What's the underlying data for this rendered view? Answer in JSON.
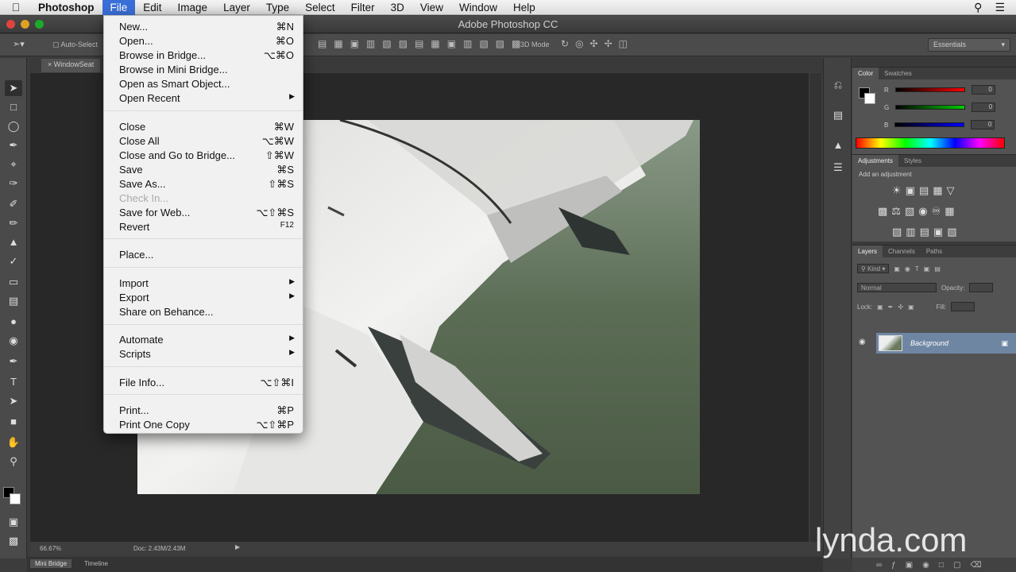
{
  "menubar": {
    "app_name": "Photoshop",
    "items": [
      "File",
      "Edit",
      "Image",
      "Layer",
      "Type",
      "Select",
      "Filter",
      "3D",
      "View",
      "Window",
      "Help"
    ],
    "active": "File"
  },
  "window": {
    "title": "Adobe Photoshop CC"
  },
  "options": {
    "auto_select": "Auto-Select",
    "mode_3d": "3D Mode",
    "workspace": "Essentials"
  },
  "document": {
    "tab": "WindowSeat"
  },
  "file_menu": {
    "items": [
      {
        "label": "New...",
        "shortcut": "⌘N"
      },
      {
        "label": "Open...",
        "shortcut": "⌘O"
      },
      {
        "label": "Browse in Bridge...",
        "shortcut": "⌥⌘O"
      },
      {
        "label": "Browse in Mini Bridge...",
        "shortcut": ""
      },
      {
        "label": "Open as Smart Object...",
        "shortcut": ""
      },
      {
        "label": "Open Recent",
        "shortcut": "",
        "submenu": true
      },
      {
        "label": "Close",
        "shortcut": "⌘W"
      },
      {
        "label": "Close All",
        "shortcut": "⌥⌘W"
      },
      {
        "label": "Close and Go to Bridge...",
        "shortcut": "⇧⌘W"
      },
      {
        "label": "Save",
        "shortcut": "⌘S"
      },
      {
        "label": "Save As...",
        "shortcut": "⇧⌘S"
      },
      {
        "label": "Check In...",
        "shortcut": "",
        "disabled": true
      },
      {
        "label": "Save for Web...",
        "shortcut": "⌥⇧⌘S"
      },
      {
        "label": "Revert",
        "shortcut": "F12"
      },
      {
        "label": "Place...",
        "shortcut": ""
      },
      {
        "label": "Import",
        "shortcut": "",
        "submenu": true
      },
      {
        "label": "Export",
        "shortcut": "",
        "submenu": true
      },
      {
        "label": "Share on Behance...",
        "shortcut": ""
      },
      {
        "label": "Automate",
        "shortcut": "",
        "submenu": true
      },
      {
        "label": "Scripts",
        "shortcut": "",
        "submenu": true
      },
      {
        "label": "File Info...",
        "shortcut": "⌥⇧⌘I"
      },
      {
        "label": "Print...",
        "shortcut": "⌘P"
      },
      {
        "label": "Print One Copy",
        "shortcut": "⌥⇧⌘P"
      }
    ],
    "submenu_glyph": "▶"
  },
  "status": {
    "zoom": "66.67%",
    "doc": "Doc: 2.43M/2.43M"
  },
  "bottom_tabs": [
    "Mini Bridge",
    "Timeline"
  ],
  "color_panel": {
    "tabs": [
      "Color",
      "Swatches"
    ],
    "channels": [
      {
        "label": "R",
        "value": "0"
      },
      {
        "label": "G",
        "value": "0"
      },
      {
        "label": "B",
        "value": "0"
      }
    ]
  },
  "adjustments_panel": {
    "tabs": [
      "Adjustments",
      "Styles"
    ],
    "label": "Add an adjustment"
  },
  "layers_panel": {
    "tabs": [
      "Layers",
      "Channels",
      "Paths"
    ],
    "kind": "Kind",
    "blend_mode": "Normal",
    "opacity_label": "Opacity:",
    "lock_label": "Lock:",
    "fill_label": "Fill:",
    "layer_name": "Background"
  },
  "watermark": "lynda.com",
  "colors": {
    "menu_highlight": "#3a6fd8",
    "layer_selected": "#6f86a3",
    "panel_bg": "#535353"
  }
}
